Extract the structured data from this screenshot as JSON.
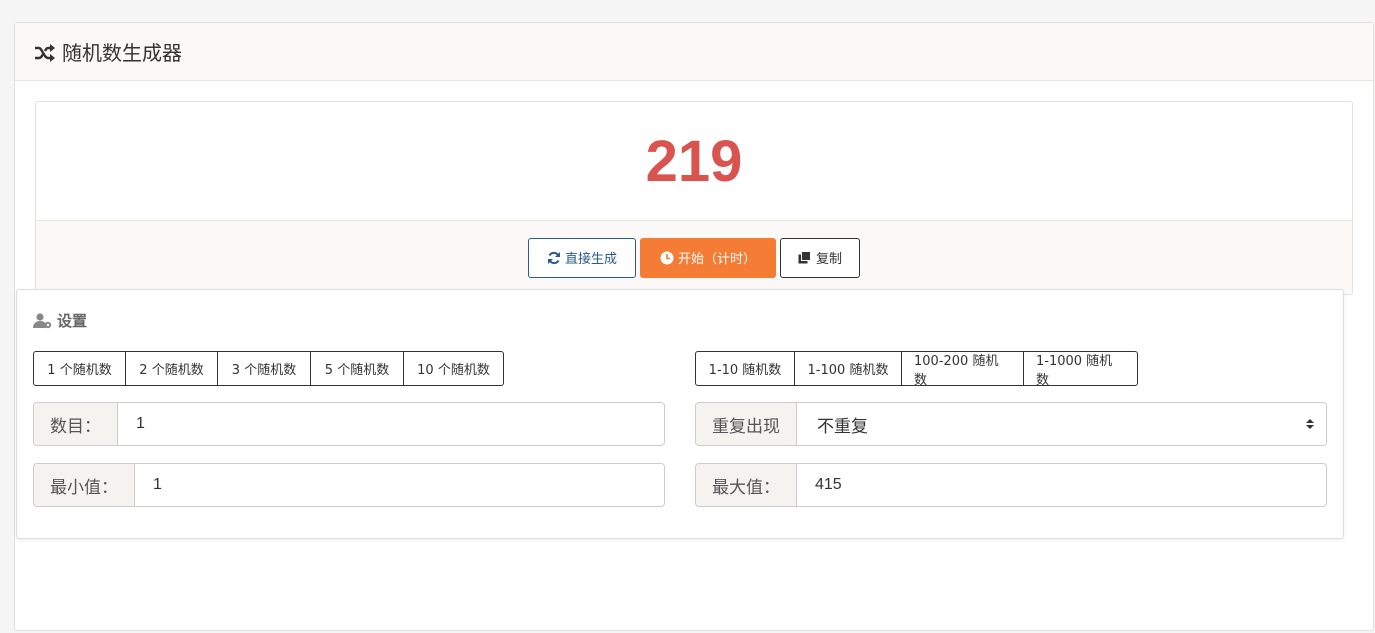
{
  "header": {
    "title": "随机数生成器",
    "icon": "shuffle-icon"
  },
  "result": {
    "value": "219",
    "color": "#d9534f"
  },
  "actions": {
    "direct_label": "直接生成",
    "start_label": "开始（计时）",
    "copy_label": "复制",
    "start_color": "#f47c35"
  },
  "settings": {
    "title": "设置",
    "count_presets": [
      "1 个随机数",
      "2 个随机数",
      "3 个随机数",
      "5 个随机数",
      "10 个随机数"
    ],
    "range_presets": [
      "1-10 随机数",
      "1-100 随机数",
      "100-200 随机数",
      "1-1000 随机数"
    ],
    "count": {
      "label": "数目：",
      "value": "1"
    },
    "repeat": {
      "label": "重复出现",
      "value": "不重复"
    },
    "min": {
      "label": "最小值：",
      "value": "1"
    },
    "max": {
      "label": "最大值：",
      "value": "415"
    }
  }
}
